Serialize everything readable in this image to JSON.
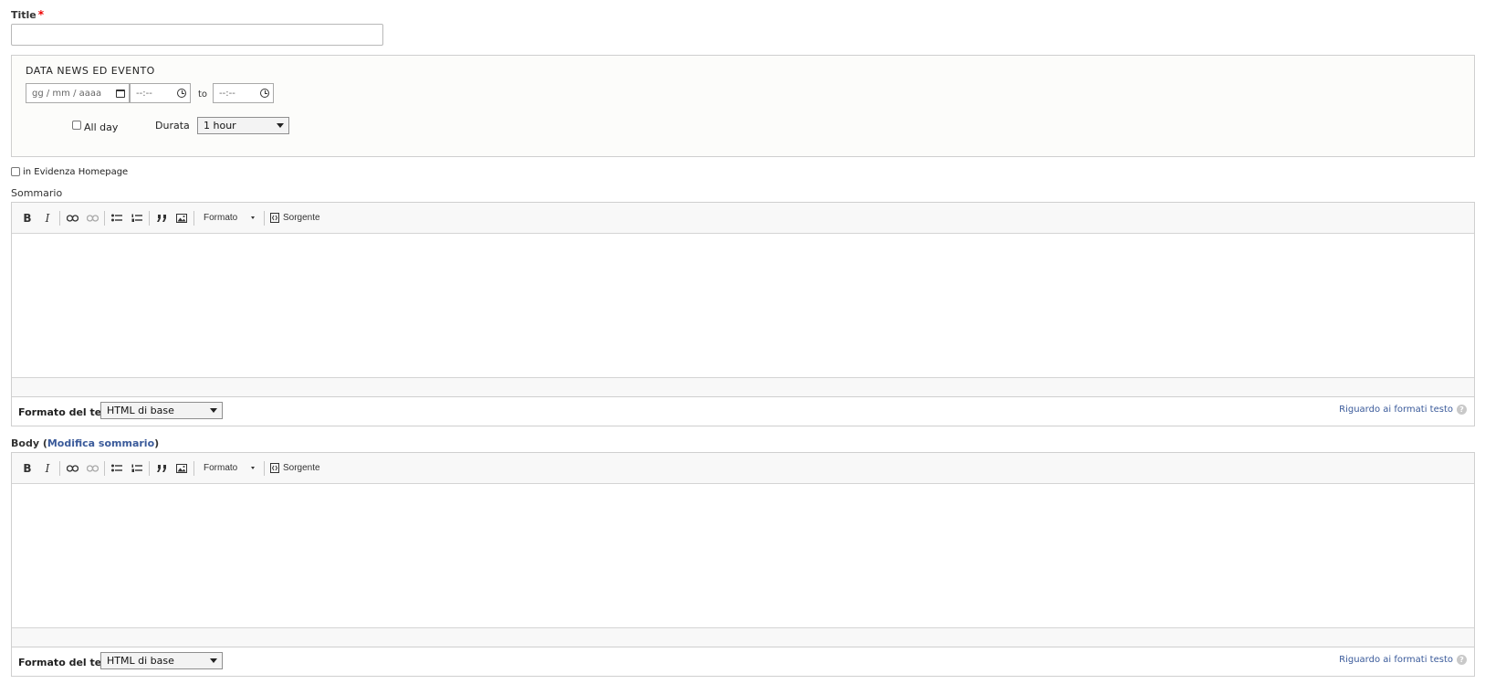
{
  "title_field": {
    "label": "Title",
    "required_mark": "*",
    "value": ""
  },
  "date_group": {
    "legend": "DATA NEWS ED EVENTO",
    "start_date_placeholder": "gg / mm / aaaa",
    "start_time_placeholder": "--:--",
    "to_label": "to",
    "end_time_placeholder": "--:--",
    "all_day_label": "All day",
    "duration_label": "Durata",
    "duration_value": "1 hour"
  },
  "featured": {
    "label": "in Evidenza Homepage"
  },
  "summary": {
    "label": "Sommario",
    "toolbar": {
      "bold": "B",
      "italic": "I",
      "format_label": "Formato",
      "source_label": "Sorgente"
    },
    "text_format_label": "Formato del testo",
    "text_format_value": "HTML di base",
    "guide_link": "Riguardo ai formati testo",
    "help_glyph": "?"
  },
  "body": {
    "label": "Body",
    "edit_summary_link": "Modifica sommario",
    "toolbar": {
      "bold": "B",
      "italic": "I",
      "format_label": "Formato",
      "source_label": "Sorgente"
    },
    "text_format_label": "Formato del testo",
    "text_format_value": "HTML di base",
    "guide_link": "Riguardo ai formati testo",
    "help_glyph": "?"
  }
}
